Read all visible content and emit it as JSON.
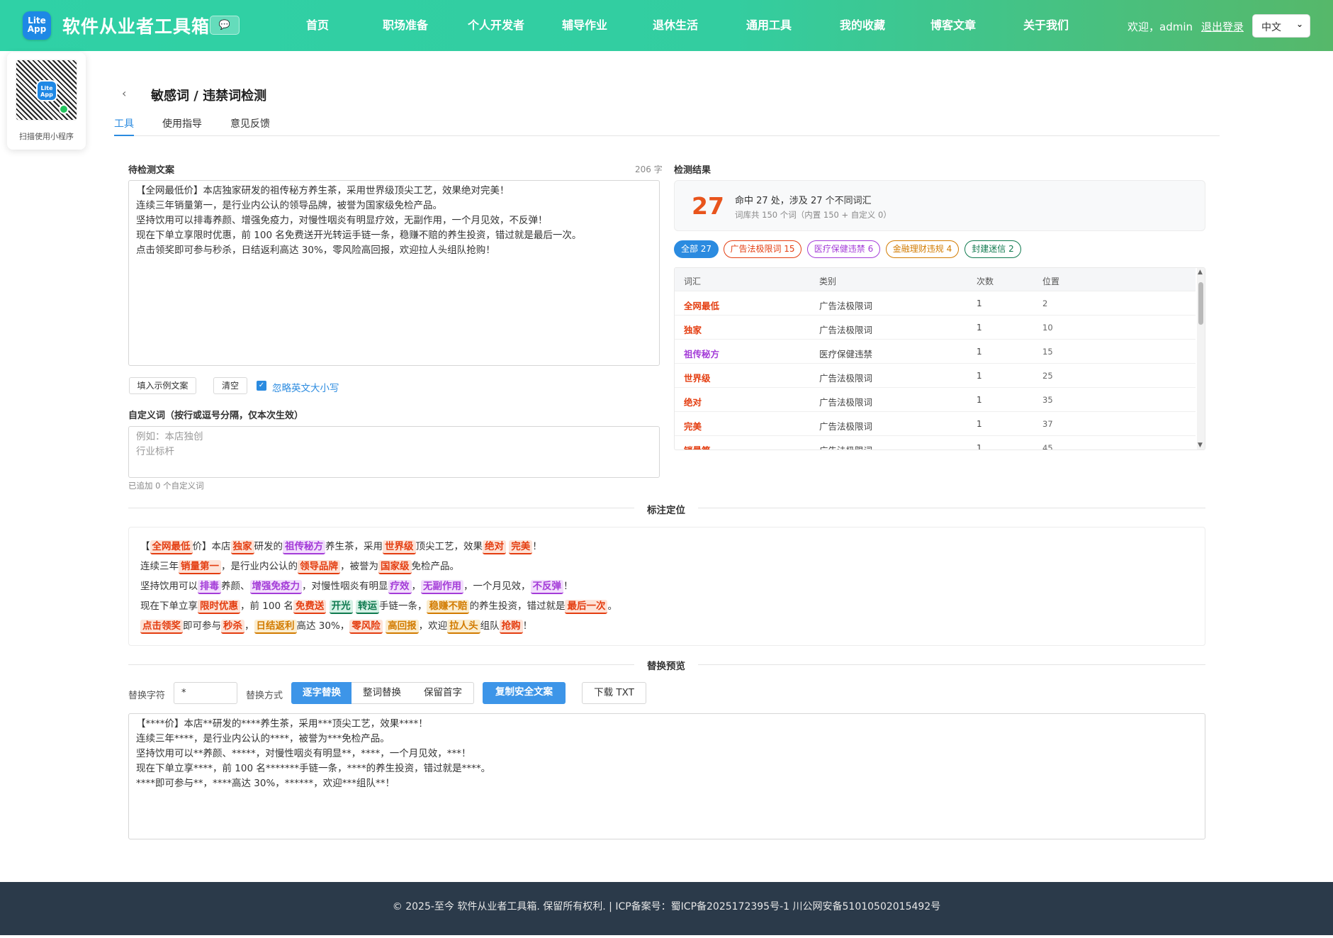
{
  "header": {
    "logo_text": "Lite App",
    "brand": "软件从业者工具箱",
    "nav": [
      "首页",
      "职场准备",
      "个人开发者",
      "辅导作业",
      "退休生活",
      "通用工具",
      "我的收藏",
      "博客文章",
      "关于我们"
    ],
    "welcome": "欢迎，admin",
    "logout": "退出登录",
    "lang": "中文"
  },
  "qr": {
    "logo_text": "Lite App",
    "caption": "扫描使用小程序"
  },
  "page": {
    "title": "敏感词 / 违禁词检测",
    "tabs": [
      "工具",
      "使用指导",
      "意见反馈"
    ]
  },
  "input": {
    "label": "待检测文案",
    "count": "206 字",
    "text": "【全网最低价】本店独家研发的祖传秘方养生茶，采用世界级顶尖工艺，效果绝对完美！\n连续三年销量第一，是行业内公认的领导品牌，被誉为国家级免检产品。\n坚持饮用可以排毒养颜、增强免疫力，对慢性咽炎有明显疗效，无副作用，一个月见效，不反弹！\n现在下单立享限时优惠，前 100 名免费送开光转运手链一条，稳赚不赔的养生投资，错过就是最后一次。\n点击领奖即可参与秒杀，日结返利高达 30%，零风险高回报，欢迎拉人头组队抢购！",
    "fill_example": "填入示例文案",
    "clear": "清空",
    "ignore_case": "忽略英文大小写",
    "custom_label": "自定义词（按行或逗号分隔，仅本次生效）",
    "custom_placeholder": "例如：本店独创\n行业标杆",
    "custom_count": "已追加 0 个自定义词"
  },
  "result": {
    "label": "检测结果",
    "total": "27",
    "hit_text": "命中 27 处，涉及 27 个不同词汇",
    "lib_text": "词库共 150 个词（内置 150 + 自定义 0）",
    "filters": [
      {
        "label": "全部 27",
        "color": "#2b8be0"
      },
      {
        "label": "广告法极限词 15",
        "color": "#e43d10"
      },
      {
        "label": "医疗保健违禁 6",
        "color": "#a43cd8"
      },
      {
        "label": "金融理财违规 4",
        "color": "#d27b00"
      },
      {
        "label": "封建迷信 2",
        "color": "#0f7a4f"
      }
    ],
    "columns": [
      "词汇",
      "类别",
      "次数",
      "位置"
    ],
    "rows": [
      {
        "word": "全网最低",
        "cat": "广告法极限词",
        "n": "1",
        "pos": "2",
        "color": "#e43d10"
      },
      {
        "word": "独家",
        "cat": "广告法极限词",
        "n": "1",
        "pos": "10",
        "color": "#e43d10"
      },
      {
        "word": "祖传秘方",
        "cat": "医疗保健违禁",
        "n": "1",
        "pos": "15",
        "color": "#a43cd8"
      },
      {
        "word": "世界级",
        "cat": "广告法极限词",
        "n": "1",
        "pos": "25",
        "color": "#e43d10"
      },
      {
        "word": "绝对",
        "cat": "广告法极限词",
        "n": "1",
        "pos": "35",
        "color": "#e43d10"
      },
      {
        "word": "完美",
        "cat": "广告法极限词",
        "n": "1",
        "pos": "37",
        "color": "#e43d10"
      },
      {
        "word": "销量第一",
        "cat": "广告法极限词",
        "n": "1",
        "pos": "45",
        "color": "#e43d10"
      }
    ]
  },
  "annotation": {
    "title": "标注定位",
    "lines": [
      [
        {
          "t": "【"
        },
        {
          "t": "全网最低",
          "k": "r"
        },
        {
          "t": "价】本店"
        },
        {
          "t": "独家",
          "k": "r"
        },
        {
          "t": "研发的"
        },
        {
          "t": "祖传秘方",
          "k": "p"
        },
        {
          "t": "养生茶，采用"
        },
        {
          "t": "世界级",
          "k": "r"
        },
        {
          "t": "顶尖工艺，效果"
        },
        {
          "t": "绝对",
          "k": "r"
        },
        {
          "t": " "
        },
        {
          "t": "完美",
          "k": "r"
        },
        {
          "t": "！"
        }
      ],
      [
        {
          "t": "连续三年"
        },
        {
          "t": "销量第一",
          "k": "r"
        },
        {
          "t": "，是行业内公认的"
        },
        {
          "t": "领导品牌",
          "k": "r"
        },
        {
          "t": "，被誉为"
        },
        {
          "t": "国家级",
          "k": "r"
        },
        {
          "t": "免检产品。"
        }
      ],
      [
        {
          "t": "坚持饮用可以"
        },
        {
          "t": "排毒",
          "k": "p"
        },
        {
          "t": "养颜、"
        },
        {
          "t": "增强免疫力",
          "k": "p"
        },
        {
          "t": "，对慢性咽炎有明显"
        },
        {
          "t": "疗效",
          "k": "p"
        },
        {
          "t": "，"
        },
        {
          "t": "无副作用",
          "k": "p"
        },
        {
          "t": "，一个月见效，"
        },
        {
          "t": "不反弹",
          "k": "p"
        },
        {
          "t": "！"
        }
      ],
      [
        {
          "t": "现在下单立享"
        },
        {
          "t": "限时优惠",
          "k": "r"
        },
        {
          "t": "，前 100 名"
        },
        {
          "t": "免费送",
          "k": "r"
        },
        {
          "t": " "
        },
        {
          "t": "开光",
          "k": "g"
        },
        {
          "t": " "
        },
        {
          "t": "转运",
          "k": "g"
        },
        {
          "t": "手链一条，"
        },
        {
          "t": "稳赚不赔",
          "k": "o"
        },
        {
          "t": "的养生投资，错过就是"
        },
        {
          "t": "最后一次",
          "k": "r"
        },
        {
          "t": "。"
        }
      ],
      [
        {
          "t": "点击领奖",
          "k": "r"
        },
        {
          "t": "即可参与"
        },
        {
          "t": "秒杀",
          "k": "r"
        },
        {
          "t": "，"
        },
        {
          "t": "日结返利",
          "k": "o"
        },
        {
          "t": "高达 30%，"
        },
        {
          "t": "零风险",
          "k": "r"
        },
        {
          "t": " "
        },
        {
          "t": "高回报",
          "k": "o"
        },
        {
          "t": "，欢迎"
        },
        {
          "t": "拉人头",
          "k": "o"
        },
        {
          "t": "组队"
        },
        {
          "t": "抢购",
          "k": "r"
        },
        {
          "t": "！"
        }
      ]
    ]
  },
  "replace": {
    "title": "替换预览",
    "char_label": "替换字符",
    "char_value": "*",
    "mode_label": "替换方式",
    "modes": [
      "逐字替换",
      "整词替换",
      "保留首字"
    ],
    "copy": "复制安全文案",
    "download": "下载 TXT",
    "output": "【****价】本店**研发的****养生茶，采用***顶尖工艺，效果****！\n连续三年****，是行业内公认的****，被誉为***免检产品。\n坚持饮用可以**养颜、*****，对慢性咽炎有明显**，****，一个月见效，***！\n现在下单立享****，前 100 名*******手链一条，****的养生投资，错过就是****。\n****即可参与**，****高达 30%，******，欢迎***组队**！"
  },
  "footer": {
    "text": "© 2025-至今 软件从业者工具箱. 保留所有权利.   |   ICP备案号：蜀ICP备2025172395号-1    川公网安备51010502015492号"
  }
}
